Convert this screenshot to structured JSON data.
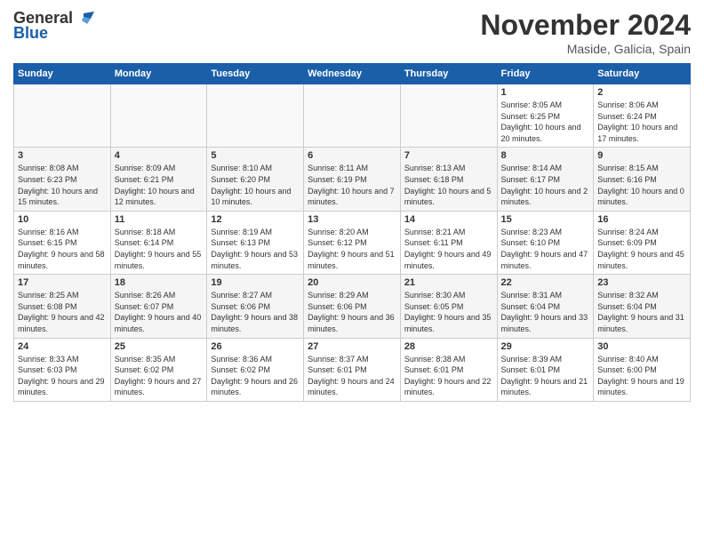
{
  "header": {
    "logo_line1": "General",
    "logo_line2": "Blue",
    "month_title": "November 2024",
    "location": "Maside, Galicia, Spain"
  },
  "weekdays": [
    "Sunday",
    "Monday",
    "Tuesday",
    "Wednesday",
    "Thursday",
    "Friday",
    "Saturday"
  ],
  "weeks": [
    [
      {
        "day": "",
        "info": ""
      },
      {
        "day": "",
        "info": ""
      },
      {
        "day": "",
        "info": ""
      },
      {
        "day": "",
        "info": ""
      },
      {
        "day": "",
        "info": ""
      },
      {
        "day": "1",
        "info": "Sunrise: 8:05 AM\nSunset: 6:25 PM\nDaylight: 10 hours and 20 minutes."
      },
      {
        "day": "2",
        "info": "Sunrise: 8:06 AM\nSunset: 6:24 PM\nDaylight: 10 hours and 17 minutes."
      }
    ],
    [
      {
        "day": "3",
        "info": "Sunrise: 8:08 AM\nSunset: 6:23 PM\nDaylight: 10 hours and 15 minutes."
      },
      {
        "day": "4",
        "info": "Sunrise: 8:09 AM\nSunset: 6:21 PM\nDaylight: 10 hours and 12 minutes."
      },
      {
        "day": "5",
        "info": "Sunrise: 8:10 AM\nSunset: 6:20 PM\nDaylight: 10 hours and 10 minutes."
      },
      {
        "day": "6",
        "info": "Sunrise: 8:11 AM\nSunset: 6:19 PM\nDaylight: 10 hours and 7 minutes."
      },
      {
        "day": "7",
        "info": "Sunrise: 8:13 AM\nSunset: 6:18 PM\nDaylight: 10 hours and 5 minutes."
      },
      {
        "day": "8",
        "info": "Sunrise: 8:14 AM\nSunset: 6:17 PM\nDaylight: 10 hours and 2 minutes."
      },
      {
        "day": "9",
        "info": "Sunrise: 8:15 AM\nSunset: 6:16 PM\nDaylight: 10 hours and 0 minutes."
      }
    ],
    [
      {
        "day": "10",
        "info": "Sunrise: 8:16 AM\nSunset: 6:15 PM\nDaylight: 9 hours and 58 minutes."
      },
      {
        "day": "11",
        "info": "Sunrise: 8:18 AM\nSunset: 6:14 PM\nDaylight: 9 hours and 55 minutes."
      },
      {
        "day": "12",
        "info": "Sunrise: 8:19 AM\nSunset: 6:13 PM\nDaylight: 9 hours and 53 minutes."
      },
      {
        "day": "13",
        "info": "Sunrise: 8:20 AM\nSunset: 6:12 PM\nDaylight: 9 hours and 51 minutes."
      },
      {
        "day": "14",
        "info": "Sunrise: 8:21 AM\nSunset: 6:11 PM\nDaylight: 9 hours and 49 minutes."
      },
      {
        "day": "15",
        "info": "Sunrise: 8:23 AM\nSunset: 6:10 PM\nDaylight: 9 hours and 47 minutes."
      },
      {
        "day": "16",
        "info": "Sunrise: 8:24 AM\nSunset: 6:09 PM\nDaylight: 9 hours and 45 minutes."
      }
    ],
    [
      {
        "day": "17",
        "info": "Sunrise: 8:25 AM\nSunset: 6:08 PM\nDaylight: 9 hours and 42 minutes."
      },
      {
        "day": "18",
        "info": "Sunrise: 8:26 AM\nSunset: 6:07 PM\nDaylight: 9 hours and 40 minutes."
      },
      {
        "day": "19",
        "info": "Sunrise: 8:27 AM\nSunset: 6:06 PM\nDaylight: 9 hours and 38 minutes."
      },
      {
        "day": "20",
        "info": "Sunrise: 8:29 AM\nSunset: 6:06 PM\nDaylight: 9 hours and 36 minutes."
      },
      {
        "day": "21",
        "info": "Sunrise: 8:30 AM\nSunset: 6:05 PM\nDaylight: 9 hours and 35 minutes."
      },
      {
        "day": "22",
        "info": "Sunrise: 8:31 AM\nSunset: 6:04 PM\nDaylight: 9 hours and 33 minutes."
      },
      {
        "day": "23",
        "info": "Sunrise: 8:32 AM\nSunset: 6:04 PM\nDaylight: 9 hours and 31 minutes."
      }
    ],
    [
      {
        "day": "24",
        "info": "Sunrise: 8:33 AM\nSunset: 6:03 PM\nDaylight: 9 hours and 29 minutes."
      },
      {
        "day": "25",
        "info": "Sunrise: 8:35 AM\nSunset: 6:02 PM\nDaylight: 9 hours and 27 minutes."
      },
      {
        "day": "26",
        "info": "Sunrise: 8:36 AM\nSunset: 6:02 PM\nDaylight: 9 hours and 26 minutes."
      },
      {
        "day": "27",
        "info": "Sunrise: 8:37 AM\nSunset: 6:01 PM\nDaylight: 9 hours and 24 minutes."
      },
      {
        "day": "28",
        "info": "Sunrise: 8:38 AM\nSunset: 6:01 PM\nDaylight: 9 hours and 22 minutes."
      },
      {
        "day": "29",
        "info": "Sunrise: 8:39 AM\nSunset: 6:01 PM\nDaylight: 9 hours and 21 minutes."
      },
      {
        "day": "30",
        "info": "Sunrise: 8:40 AM\nSunset: 6:00 PM\nDaylight: 9 hours and 19 minutes."
      }
    ]
  ]
}
